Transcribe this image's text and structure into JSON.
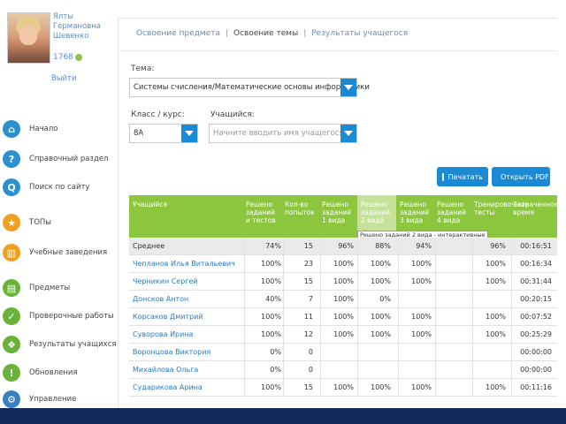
{
  "user": {
    "name_line1": "Ялты",
    "name_line2": "Германовна",
    "name_line3": "Шевенко",
    "points": "1768",
    "logout": "Выйти"
  },
  "nav": {
    "items": [
      {
        "label": "Начало",
        "icon": "home-icon"
      },
      {
        "label": "Справочный раздел",
        "icon": "question-icon"
      },
      {
        "label": "Поиск по сайту",
        "icon": "search-icon"
      },
      {
        "label": "ТОПы",
        "icon": "star-icon"
      },
      {
        "label": "Учебные заведения",
        "icon": "building-icon"
      },
      {
        "label": "Предметы",
        "icon": "book-icon"
      },
      {
        "label": "Проверочные работы",
        "icon": "check-icon"
      },
      {
        "label": "Результаты учащихся",
        "icon": "people-icon"
      },
      {
        "label": "Обновления",
        "icon": "exclamation-icon"
      },
      {
        "label": "Управление",
        "icon": "settings-icon"
      }
    ]
  },
  "tabs": {
    "subject": "Освоение предмета",
    "topic": "Освоение темы",
    "results": "Результаты учащегося",
    "sep": "|"
  },
  "form": {
    "topic_label": "Тема:",
    "topic_value": "Системы счисления/Математические основы информатики",
    "class_label": "Класс / курс:",
    "class_value": "8А",
    "student_label": "Учащийся:",
    "student_placeholder": "Начните вводить имя учащегося"
  },
  "buttons": {
    "print": "Печатать",
    "pdf": "Открыть PDF"
  },
  "table": {
    "headers": [
      "Учащийся",
      "Решено заданий и тестов",
      "Кол-во попыток",
      "Решено заданий 1 вида",
      "Решено заданий 2 вида",
      "Решено заданий 3 вида",
      "Решено заданий 4 вида",
      "Тренировочные тесты",
      "Затраченное время"
    ],
    "tooltip": "Решено заданий 2 вида - интерактивные",
    "rows": [
      [
        "Среднее",
        "74%",
        "15",
        "96%",
        "88%",
        "94%",
        "",
        "96%",
        "00:16:51"
      ],
      [
        "Чепланов Илья Витальевич",
        "100%",
        "23",
        "100%",
        "100%",
        "100%",
        "",
        "100%",
        "00:16:34"
      ],
      [
        "Черникин Сергей",
        "100%",
        "15",
        "100%",
        "100%",
        "100%",
        "",
        "100%",
        "00:31:44"
      ],
      [
        "Донсков Антон",
        "40%",
        "7",
        "100%",
        "0%",
        "",
        "",
        "",
        "00:20:15"
      ],
      [
        "Корсаков Дмитрий",
        "100%",
        "11",
        "100%",
        "100%",
        "100%",
        "",
        "100%",
        "00:07:52"
      ],
      [
        "Суворова Ирина",
        "100%",
        "12",
        "100%",
        "100%",
        "100%",
        "",
        "100%",
        "00:25:29"
      ],
      [
        "Воронцова Виктория",
        "0%",
        "0",
        "",
        "",
        "",
        "",
        "",
        "00:00:00"
      ],
      [
        "Михайлова Ольга",
        "0%",
        "0",
        "",
        "",
        "",
        "",
        "",
        "00:00:00"
      ],
      [
        "Сударикова Арина",
        "100%",
        "15",
        "100%",
        "100%",
        "100%",
        "",
        "100%",
        "00:11:16"
      ]
    ]
  },
  "colors": {
    "accent": "#1a8ad4",
    "header_green": "#8cc63f",
    "link": "#2b7bc2"
  }
}
